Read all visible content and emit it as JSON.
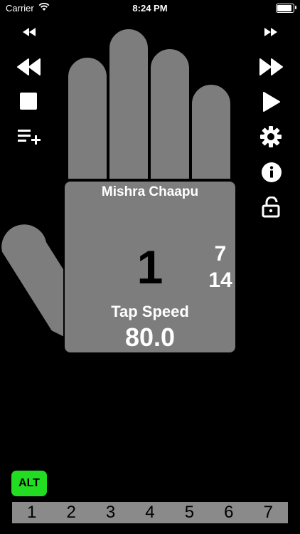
{
  "status_bar": {
    "carrier": "Carrier",
    "time": "8:24 PM"
  },
  "hand_card": {
    "title": "Mishra Chaapu",
    "current_beat": "1",
    "beats_per_cycle": "7",
    "total_beats": "14",
    "tap_speed_label": "Tap Speed",
    "tap_speed_value": "80.0"
  },
  "left_controls": [
    "skip-back-small-icon",
    "rewind-icon",
    "stop-icon",
    "add-to-playlist-icon"
  ],
  "right_controls": [
    "skip-forward-small-icon",
    "fast-forward-icon",
    "play-icon",
    "settings-gear-icon",
    "info-icon",
    "unlock-icon"
  ],
  "alt_button": {
    "label": "ALT",
    "color": "#22dd22"
  },
  "number_bar": {
    "numbers": [
      "1",
      "2",
      "3",
      "4",
      "5",
      "6",
      "7"
    ]
  },
  "colors": {
    "hand": "#7d7d7d",
    "background": "#000000"
  }
}
